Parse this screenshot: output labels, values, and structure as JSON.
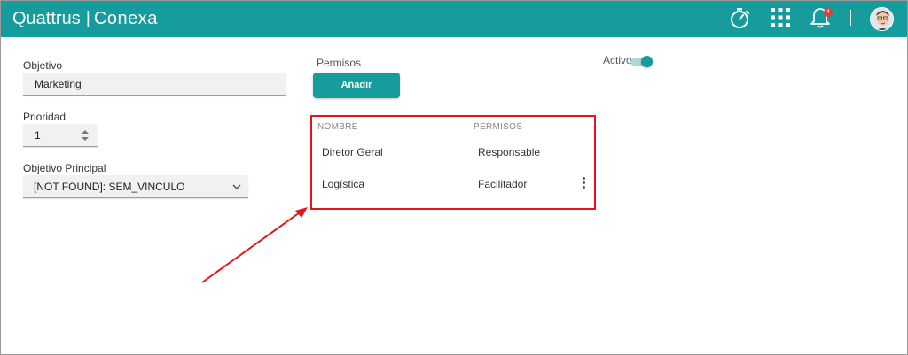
{
  "header": {
    "brand_primary": "Quattrus",
    "brand_separator": "|",
    "brand_secondary": "Conexa",
    "timer_icon": "stopwatch-icon",
    "apps_icon": "apps-grid-icon",
    "notifications_icon": "bell-icon",
    "notification_count": "4",
    "avatar_icon": "user-avatar"
  },
  "form": {
    "objetivo_label": "Objetivo",
    "objetivo_value": "Marketing",
    "prioridad_label": "Prioridad",
    "prioridad_value": "1",
    "objetivo_principal_label": "Objetivo Principal",
    "objetivo_principal_value": "[NOT FOUND]: SEM_VINCULO",
    "activo_label": "Activo",
    "activo_on": true
  },
  "permisos": {
    "section_label": "Permisos",
    "add_button_label": "Añadir",
    "columns": [
      "NOMBRE",
      "PERMISOS"
    ],
    "rows": [
      {
        "nombre": "Diretor Geral",
        "permiso": "Responsable"
      },
      {
        "nombre": "Logística",
        "permiso": "Facilitador"
      }
    ]
  },
  "colors": {
    "primary": "#169c9c",
    "highlight": "#e8141c",
    "badge": "#e53935"
  }
}
